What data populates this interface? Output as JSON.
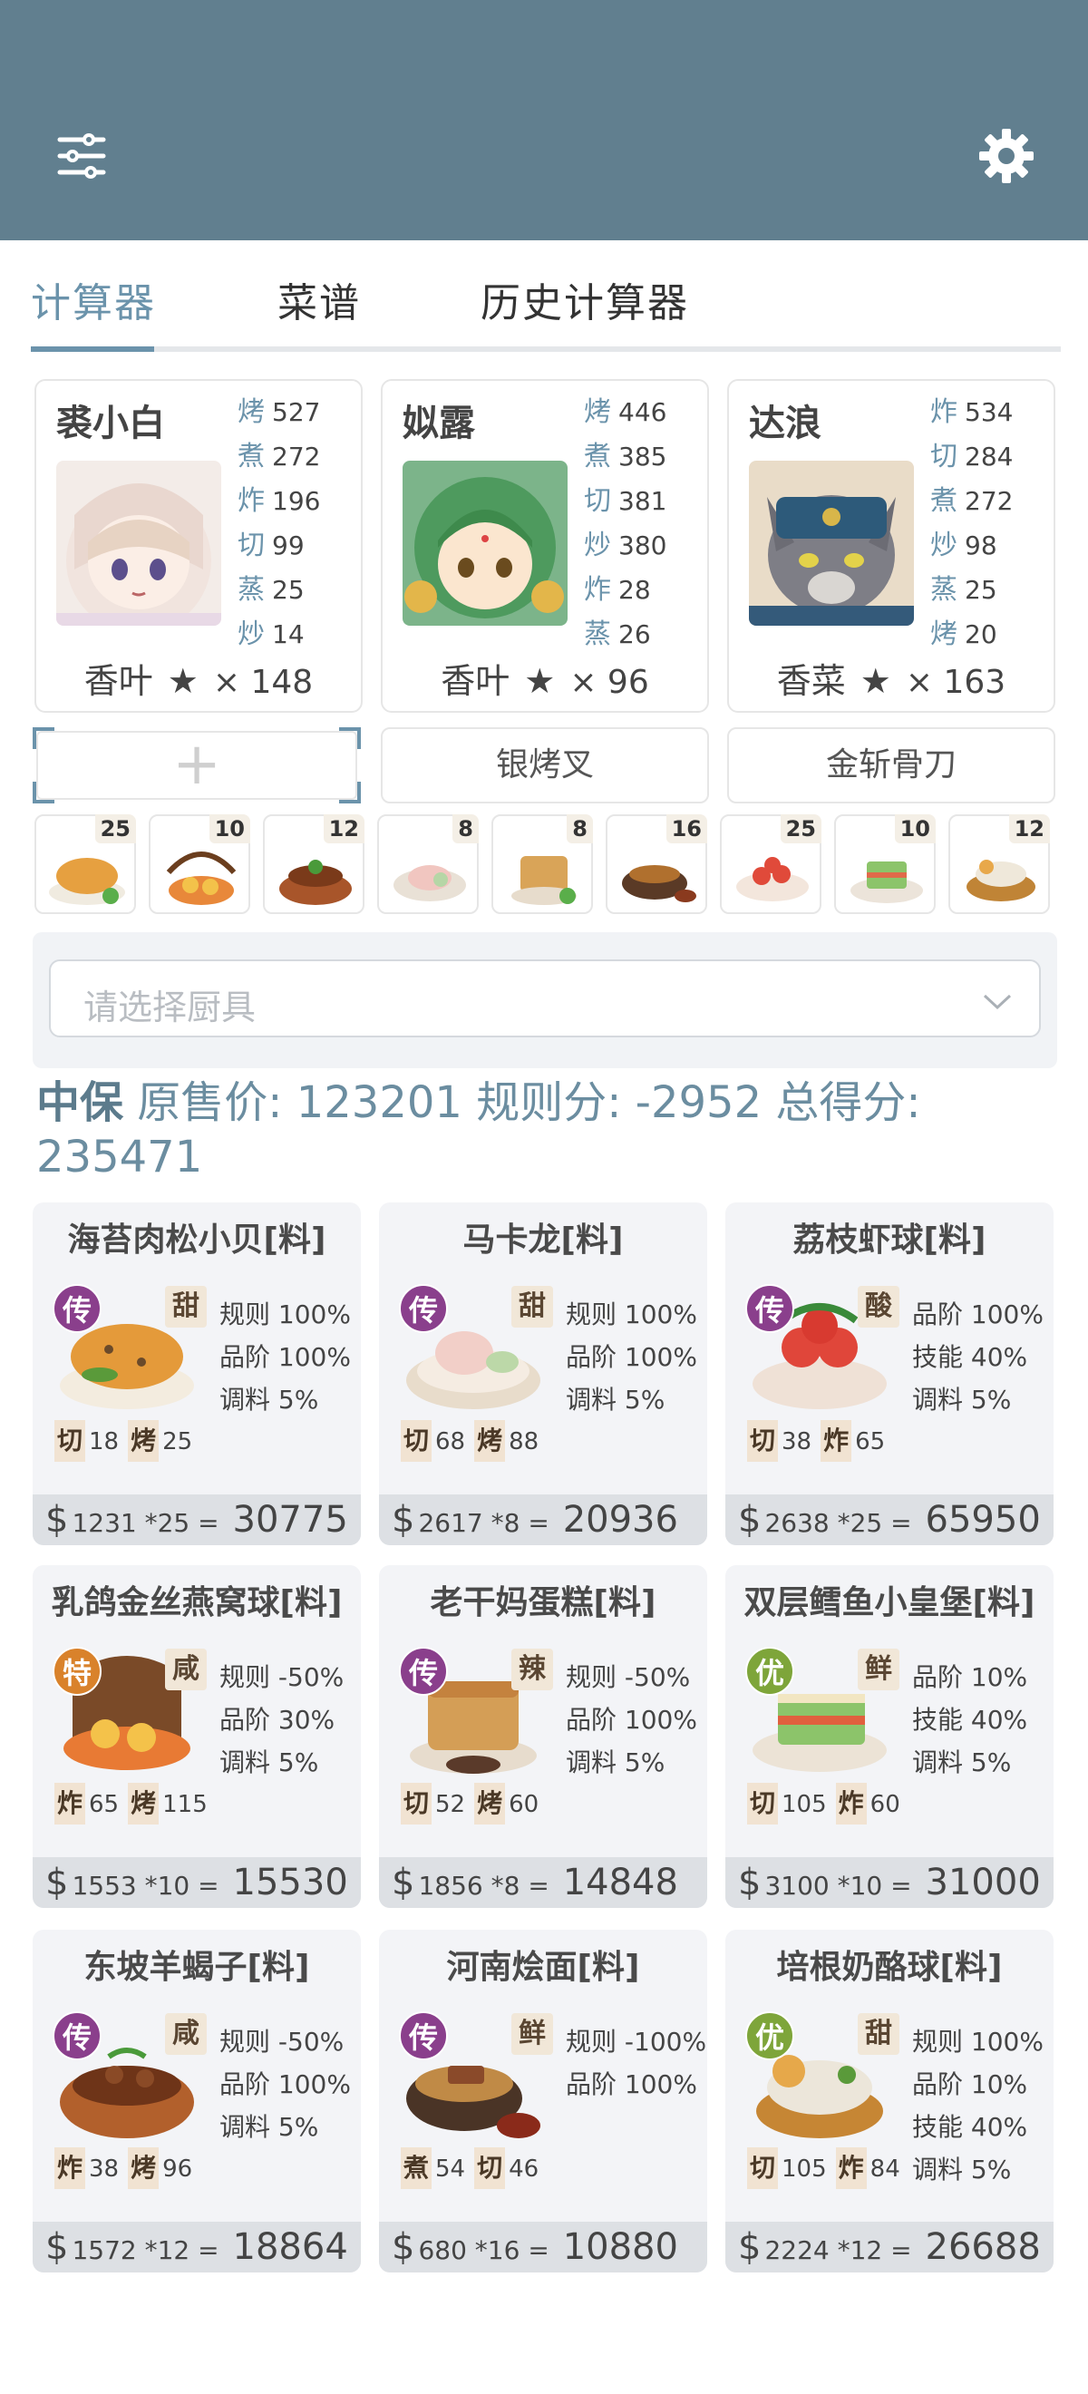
{
  "header": {
    "menu_icon": "sliders-icon",
    "settings_icon": "gear-icon",
    "bg_color": "#617f8f"
  },
  "tabs": [
    {
      "label": "计算器",
      "active": true
    },
    {
      "label": "菜谱"
    },
    {
      "label": "历史计算器"
    }
  ],
  "chefs": [
    {
      "name": "裘小白",
      "skills": [
        {
          "k": "烤",
          "v": "527"
        },
        {
          "k": "煮",
          "v": "272"
        },
        {
          "k": "炸",
          "v": "196"
        },
        {
          "k": "切",
          "v": "99"
        },
        {
          "k": "蒸",
          "v": "25"
        },
        {
          "k": "炒",
          "v": "14"
        }
      ],
      "ingredient": "香叶",
      "star": "★",
      "mult": "× 148"
    },
    {
      "name": "姒露",
      "skills": [
        {
          "k": "烤",
          "v": "446"
        },
        {
          "k": "煮",
          "v": "385"
        },
        {
          "k": "切",
          "v": "381"
        },
        {
          "k": "炒",
          "v": "380"
        },
        {
          "k": "炸",
          "v": "28"
        },
        {
          "k": "蒸",
          "v": "26"
        }
      ],
      "ingredient": "香叶",
      "star": "★",
      "mult": "× 96"
    },
    {
      "name": "达浪",
      "skills": [
        {
          "k": "炸",
          "v": "534"
        },
        {
          "k": "切",
          "v": "284"
        },
        {
          "k": "煮",
          "v": "272"
        },
        {
          "k": "炒",
          "v": "98"
        },
        {
          "k": "蒸",
          "v": "25"
        },
        {
          "k": "烤",
          "v": "20"
        }
      ],
      "ingredient": "香菜",
      "star": "★",
      "mult": "× 163"
    }
  ],
  "tools": {
    "add": "+",
    "t2": "银烤叉",
    "t3": "金斩骨刀"
  },
  "mini_dishes": [
    "25",
    "10",
    "12",
    "8",
    "8",
    "16",
    "25",
    "10",
    "12"
  ],
  "equipment_select": {
    "placeholder": "请选择厨具"
  },
  "summary": {
    "tag": "中保",
    "text": " 原售价:  123201 规则分:  -2952 总得分:  235471"
  },
  "recipes": [
    {
      "title": "海苔肉松小贝[料]",
      "rank": "传",
      "flavor": "甜",
      "rules": [
        "规则 100%",
        "品阶 100%",
        "调料 5%"
      ],
      "needs": [
        {
          "k": "切",
          "v": "18"
        },
        {
          "k": "烤",
          "v": "25"
        }
      ],
      "unit": "1231 *25",
      "total": "30775"
    },
    {
      "title": "马卡龙[料]",
      "rank": "传",
      "flavor": "甜",
      "rules": [
        "规则 100%",
        "品阶 100%",
        "调料 5%"
      ],
      "needs": [
        {
          "k": "切",
          "v": "68"
        },
        {
          "k": "烤",
          "v": "88"
        }
      ],
      "unit": "2617 *8",
      "total": "20936"
    },
    {
      "title": "荔枝虾球[料]",
      "rank": "传",
      "flavor": "酸",
      "rules": [
        "品阶 100%",
        "技能 40%",
        "调料 5%"
      ],
      "needs": [
        {
          "k": "切",
          "v": "38"
        },
        {
          "k": "炸",
          "v": "65"
        }
      ],
      "unit": "2638 *25",
      "total": "65950"
    },
    {
      "title": "乳鸽金丝燕窝球[料]",
      "rank": "特",
      "flavor": "咸",
      "rules": [
        "规则 -50%",
        "品阶 30%",
        "调料 5%"
      ],
      "needs": [
        {
          "k": "炸",
          "v": "65"
        },
        {
          "k": "烤",
          "v": "115"
        }
      ],
      "unit": "1553 *10",
      "total": "15530"
    },
    {
      "title": "老干妈蛋糕[料]",
      "rank": "传",
      "flavor": "辣",
      "rules": [
        "规则 -50%",
        "品阶 100%",
        "调料 5%"
      ],
      "needs": [
        {
          "k": "切",
          "v": "52"
        },
        {
          "k": "烤",
          "v": "60"
        }
      ],
      "unit": "1856 *8",
      "total": "14848"
    },
    {
      "title": "双层鳕鱼小皇堡[料]",
      "rank": "优",
      "flavor": "鲜",
      "rules": [
        "品阶 10%",
        "技能 40%",
        "调料 5%"
      ],
      "needs": [
        {
          "k": "切",
          "v": "105"
        },
        {
          "k": "炸",
          "v": "60"
        }
      ],
      "unit": "3100 *10",
      "total": "31000"
    },
    {
      "title": "东坡羊蝎子[料]",
      "rank": "传",
      "flavor": "咸",
      "rules": [
        "规则 -50%",
        "品阶 100%",
        "调料 5%"
      ],
      "needs": [
        {
          "k": "炸",
          "v": "38"
        },
        {
          "k": "烤",
          "v": "96"
        }
      ],
      "unit": "1572 *12",
      "total": "18864"
    },
    {
      "title": "河南烩面[料]",
      "rank": "传",
      "flavor": "鲜",
      "rules": [
        "规则 -100%",
        "品阶 100%"
      ],
      "needs": [
        {
          "k": "煮",
          "v": "54"
        },
        {
          "k": "切",
          "v": "46"
        }
      ],
      "unit": "680 *16",
      "total": "10880"
    },
    {
      "title": "培根奶酪球[料]",
      "rank": "优",
      "flavor": "甜",
      "rules": [
        "规则 100%",
        "品阶 10%",
        "技能 40%",
        "调料 5%"
      ],
      "needs": [
        {
          "k": "切",
          "v": "105"
        },
        {
          "k": "炸",
          "v": "84"
        }
      ],
      "unit": "2224 *12",
      "total": "26688"
    }
  ],
  "currency": "$",
  "rank_colors": {
    "传": "#8a3f8c",
    "特": "#d9822b",
    "优": "#7ea53a"
  },
  "accent_color": "#6b93ab"
}
